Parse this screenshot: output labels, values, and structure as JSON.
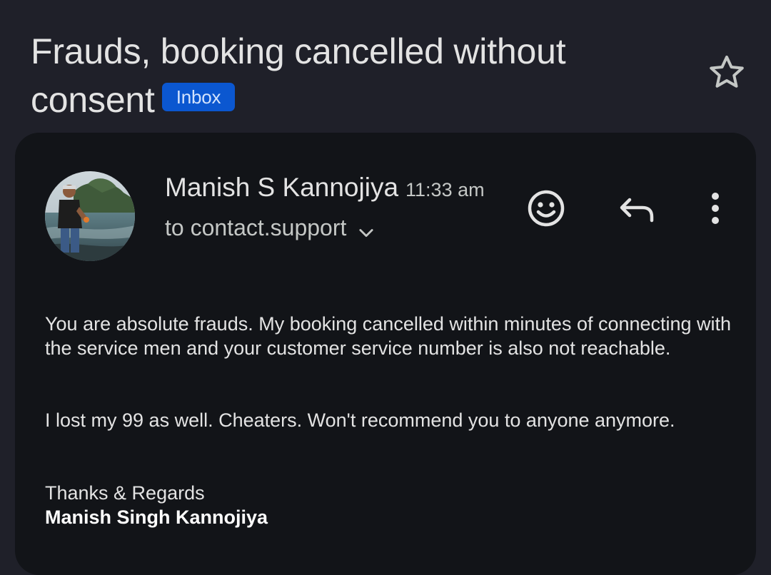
{
  "email": {
    "subject": "Frauds, booking cancelled without consent",
    "label": "Inbox",
    "starred": false
  },
  "sender": {
    "name": "Manish S Kannojiya",
    "time": "11:33 am",
    "recipient": "to contact.support"
  },
  "icons": {
    "star": "star-outline-icon",
    "emoji": "smiley-face-icon",
    "reply": "reply-arrow-icon",
    "more": "more-vert-icon",
    "expand": "chevron-down-icon"
  },
  "body": {
    "paragraph1": "You are absolute frauds. My booking cancelled within minutes of connecting with the service men and your customer service number is also not reachable.",
    "paragraph2": "I lost my 99 as well. Cheaters. Won't recommend you to anyone anymore.",
    "closing": "Thanks & Regards",
    "signature": "Manish Singh Kannojiya"
  },
  "colors": {
    "background": "#1f2029",
    "card": "#121418",
    "badge": "#0b57d0",
    "badge_text": "#d3e3fd",
    "text": "#e3e3e3",
    "muted": "#c4c7c5"
  }
}
